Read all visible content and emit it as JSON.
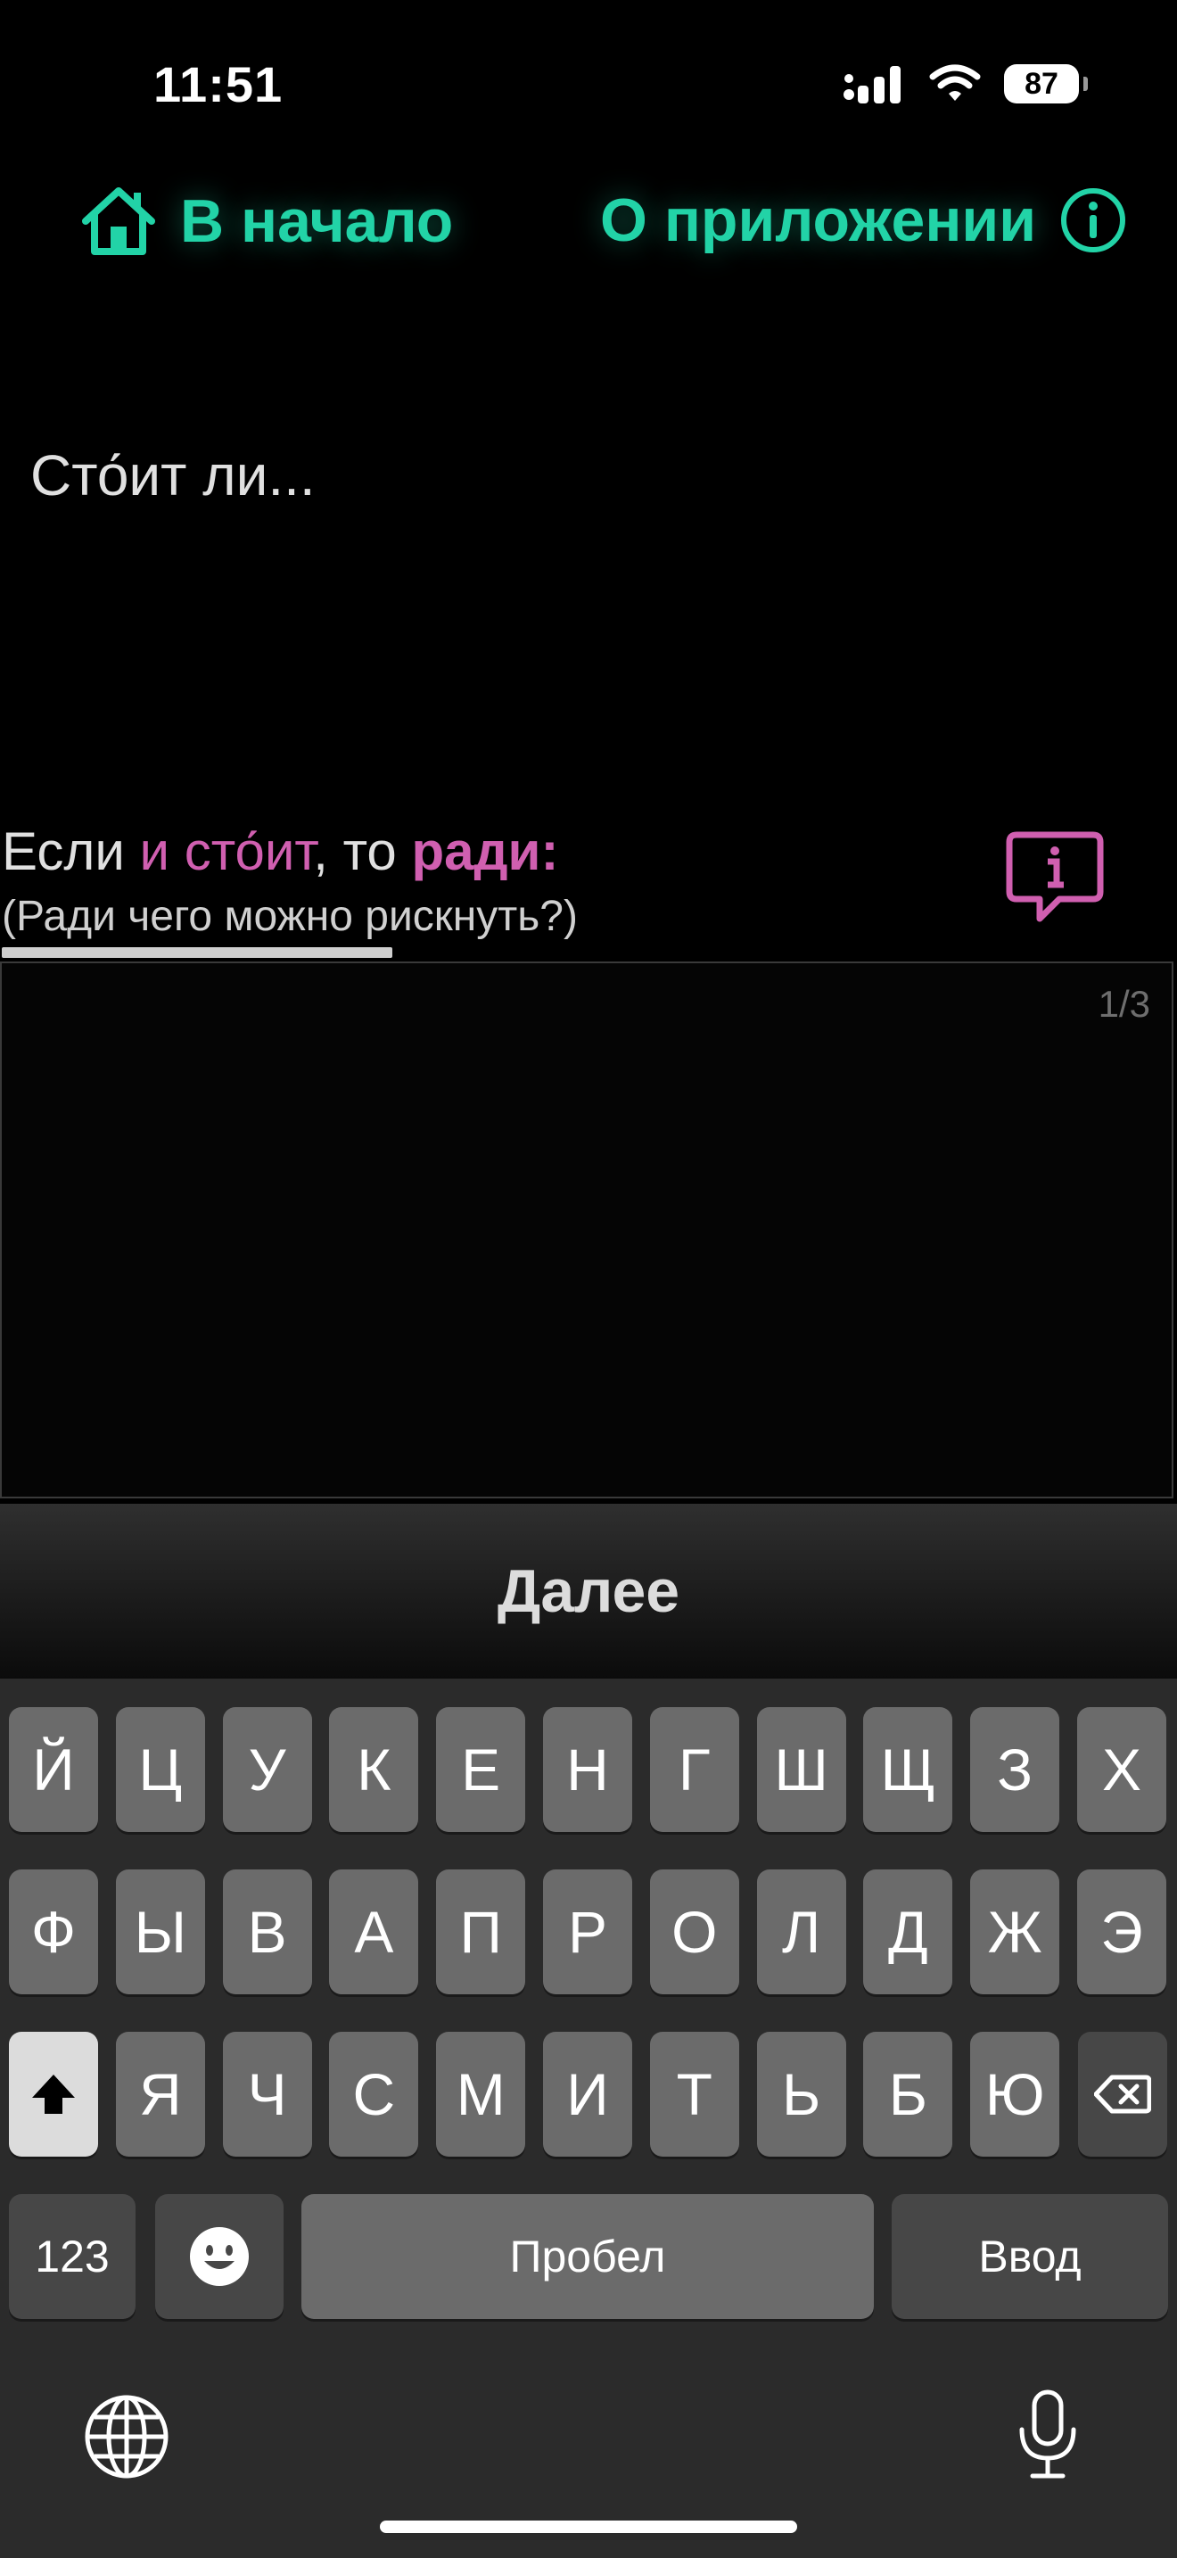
{
  "status": {
    "time": "11:51",
    "battery": "87"
  },
  "nav": {
    "home_label": "В начало",
    "about_label": "О приложении"
  },
  "question": "Сто́ит ли...",
  "prompt": {
    "part1": "Если ",
    "part2": "и сто́ит",
    "part3": ", то ",
    "part4": "ради:",
    "subtitle": "(Ради чего можно рискнуть?)",
    "progress_fraction": 0.333
  },
  "textarea": {
    "counter": "1/3",
    "value": ""
  },
  "next_button": "Далее",
  "keyboard": {
    "row1": [
      "Й",
      "Ц",
      "У",
      "К",
      "Е",
      "Н",
      "Г",
      "Ш",
      "Щ",
      "З",
      "Х"
    ],
    "row2": [
      "Ф",
      "Ы",
      "В",
      "А",
      "П",
      "Р",
      "О",
      "Л",
      "Д",
      "Ж",
      "Э"
    ],
    "row3": [
      "Я",
      "Ч",
      "С",
      "М",
      "И",
      "Т",
      "Ь",
      "Б",
      "Ю"
    ],
    "numbers_label": "123",
    "space_label": "Пробел",
    "return_label": "Ввод"
  },
  "colors": {
    "accent_green": "#22d3a7",
    "accent_pink": "#d05fb0"
  },
  "icons": [
    "home-icon",
    "info-icon",
    "hint-bubble-icon",
    "shift-icon",
    "backspace-icon",
    "emoji-icon",
    "globe-icon",
    "microphone-icon",
    "signal-icon",
    "wifi-icon",
    "battery-icon"
  ]
}
